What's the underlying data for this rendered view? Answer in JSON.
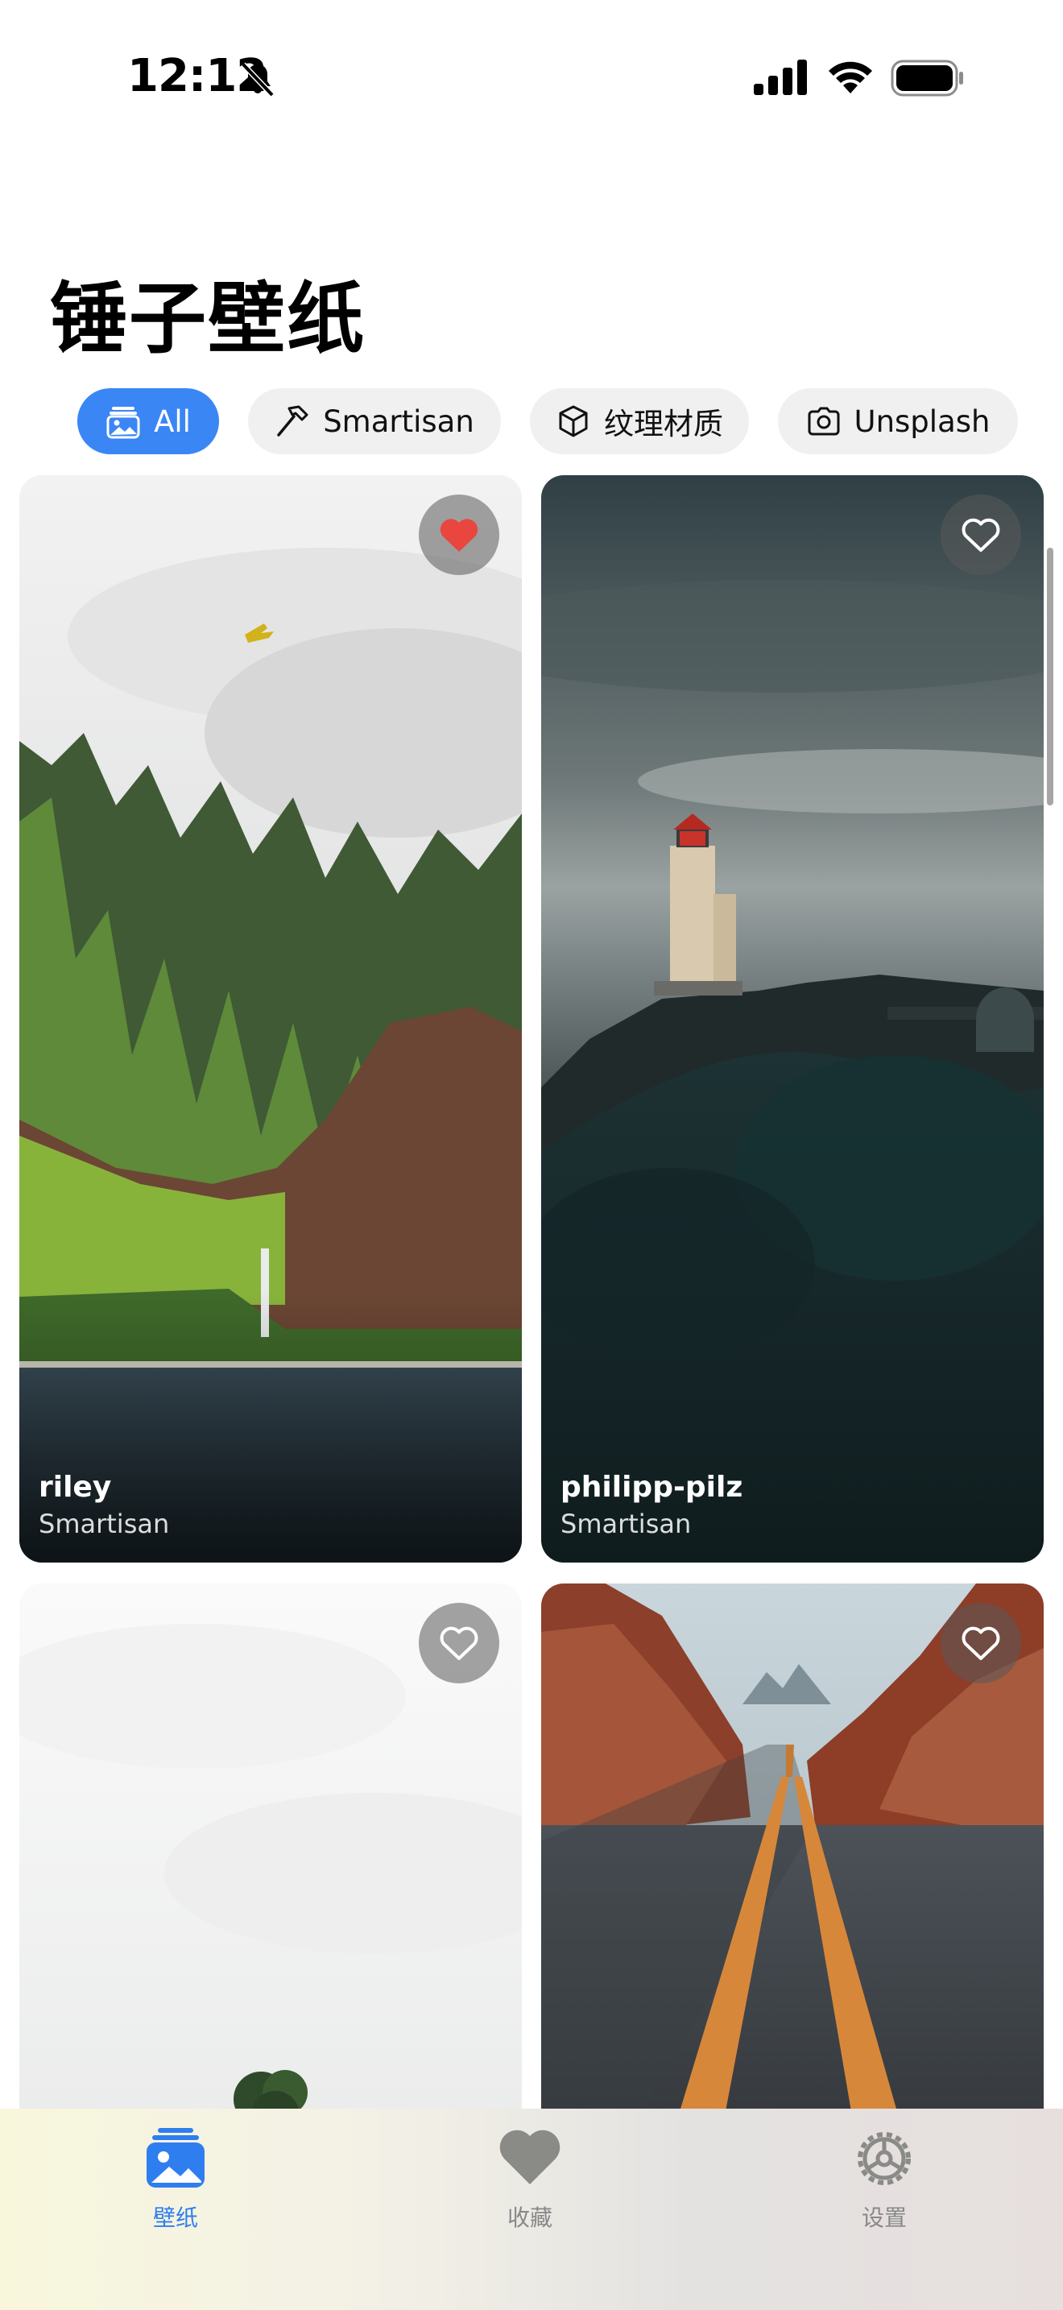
{
  "status_bar": {
    "time": "12:12"
  },
  "header": {
    "title": "锤子壁纸"
  },
  "filters": [
    {
      "label": "All",
      "icon": "photo-stack-icon",
      "active": true
    },
    {
      "label": "Smartisan",
      "icon": "hammer-icon",
      "active": false
    },
    {
      "label": "纹理材质",
      "icon": "cube-icon",
      "active": false
    },
    {
      "label": "Unsplash",
      "icon": "camera-icon",
      "active": false
    }
  ],
  "wallpapers": [
    {
      "author": "riley",
      "source": "Smartisan",
      "favorited": true,
      "favorite_icon": "heart-filled-icon"
    },
    {
      "author": "philipp-pilz",
      "source": "Smartisan",
      "favorited": false,
      "favorite_icon": "heart-outline-icon"
    },
    {
      "author": "",
      "source": "",
      "favorited": false,
      "favorite_icon": "heart-outline-icon"
    },
    {
      "author": "",
      "source": "",
      "favorited": false,
      "favorite_icon": "heart-outline-icon"
    }
  ],
  "tab_bar": {
    "tabs": [
      {
        "label": "壁纸",
        "icon": "wallpaper-icon",
        "active": true
      },
      {
        "label": "收藏",
        "icon": "heart-icon",
        "active": false
      },
      {
        "label": "设置",
        "icon": "gear-icon",
        "active": false
      }
    ]
  },
  "colors": {
    "accent": "#3a86f5",
    "favorite": "#e8463f",
    "chip_bg": "#f0f0f0"
  }
}
